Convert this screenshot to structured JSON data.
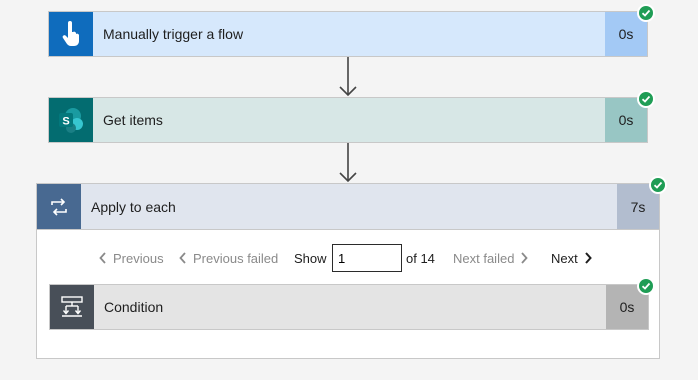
{
  "steps": {
    "trigger": {
      "title": "Manually trigger a flow",
      "duration": "0s",
      "icon": "touch-hand-icon"
    },
    "get_items": {
      "title": "Get items",
      "duration": "0s",
      "icon": "sharepoint-icon",
      "icon_letter": "S"
    },
    "apply_each": {
      "title": "Apply to each",
      "duration": "7s",
      "icon": "loop-icon",
      "pager": {
        "previous": "Previous",
        "previous_failed": "Previous failed",
        "show_label": "Show",
        "current_value": "1",
        "of_label": "of 14",
        "next_failed": "Next failed",
        "next": "Next"
      },
      "condition": {
        "title": "Condition",
        "duration": "0s",
        "icon": "condition-icon"
      }
    }
  },
  "colors": {
    "success": "#1f9d55",
    "trigger_accent": "#0f6cbd",
    "sharepoint_accent": "#036c70",
    "loop_accent": "#486991",
    "condition_accent": "#484f58"
  }
}
